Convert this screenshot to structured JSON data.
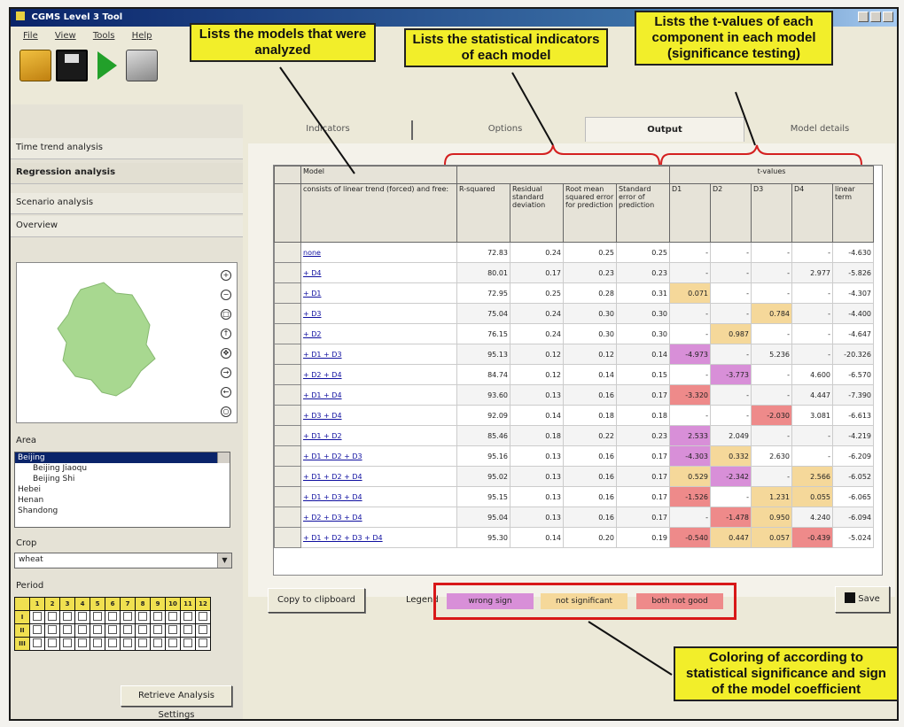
{
  "window": {
    "title": "CGMS Level 3 Tool"
  },
  "menu": [
    "File",
    "View",
    "Tools",
    "Help"
  ],
  "toolbar": [
    "open-icon",
    "save-icon",
    "run-icon",
    "print-icon"
  ],
  "sidebar": {
    "items": [
      "Time trend analysis",
      "Regression analysis",
      "Scenario analysis",
      "Overview"
    ],
    "area_label": "Area",
    "areas": [
      "Beijing",
      "Beijing Jiaoqu",
      "Beijing Shi",
      "Hebei",
      "Henan",
      "Shandong"
    ],
    "crop_label": "Crop",
    "crop_value": "wheat",
    "period_label": "Period",
    "period_header": [
      "1",
      "2",
      "3",
      "4",
      "5",
      "6",
      "7",
      "8",
      "9",
      "10",
      "11",
      "12"
    ],
    "period_rows": [
      "I",
      "II",
      "III"
    ],
    "retrieve_button": "Retrieve Analysis Settings"
  },
  "tabs": [
    "Indicators",
    "Options",
    "Output",
    "Model details"
  ],
  "active_tab": "Output",
  "grid": {
    "model_header": "Model",
    "model_subheader": "consists of linear trend (forced) and free:",
    "tvalue_header": "t-values",
    "columns": [
      "R-squared",
      "Residual standard deviation",
      "Root mean squared error for prediction",
      "Standard error of prediction",
      "D1",
      "D2",
      "D3",
      "D4",
      "linear term"
    ],
    "rows": [
      {
        "model": "none",
        "v": [
          "72.83",
          "0.24",
          "0.25",
          "0.25",
          "-",
          "-",
          "-",
          "-",
          "-4.630"
        ],
        "c": [
          "",
          "",
          "",
          "",
          "",
          "",
          "",
          "",
          ""
        ]
      },
      {
        "model": "+ D4",
        "v": [
          "80.01",
          "0.17",
          "0.23",
          "0.23",
          "-",
          "-",
          "-",
          "2.977",
          "-5.826"
        ],
        "c": [
          "",
          "",
          "",
          "",
          "",
          "",
          "",
          "",
          ""
        ]
      },
      {
        "model": "+ D1",
        "v": [
          "72.95",
          "0.25",
          "0.28",
          "0.31",
          "0.071",
          "-",
          "-",
          "-",
          "-4.307"
        ],
        "c": [
          "",
          "",
          "",
          "",
          "y",
          "",
          "",
          "",
          ""
        ]
      },
      {
        "model": "+ D3",
        "v": [
          "75.04",
          "0.24",
          "0.30",
          "0.30",
          "-",
          "-",
          "0.784",
          "-",
          "-4.400"
        ],
        "c": [
          "",
          "",
          "",
          "",
          "",
          "",
          "y",
          "",
          ""
        ]
      },
      {
        "model": "+ D2",
        "v": [
          "76.15",
          "0.24",
          "0.30",
          "0.30",
          "-",
          "0.987",
          "-",
          "-",
          "-4.647"
        ],
        "c": [
          "",
          "",
          "",
          "",
          "",
          "y",
          "",
          "",
          ""
        ]
      },
      {
        "model": "+ D1 + D3",
        "v": [
          "95.13",
          "0.12",
          "0.12",
          "0.14",
          "-4.973",
          "-",
          "5.236",
          "-",
          "-20.326"
        ],
        "c": [
          "",
          "",
          "",
          "",
          "m",
          "",
          "",
          "",
          ""
        ]
      },
      {
        "model": "+ D2 + D4",
        "v": [
          "84.74",
          "0.12",
          "0.14",
          "0.15",
          "-",
          "-3.773",
          "-",
          "4.600",
          "-6.570"
        ],
        "c": [
          "",
          "",
          "",
          "",
          "",
          "m",
          "",
          "",
          ""
        ]
      },
      {
        "model": "+ D1 + D4",
        "v": [
          "93.60",
          "0.13",
          "0.16",
          "0.17",
          "-3.320",
          "-",
          "-",
          "4.447",
          "-7.390"
        ],
        "c": [
          "",
          "",
          "",
          "",
          "r",
          "",
          "",
          "",
          ""
        ]
      },
      {
        "model": "+ D3 + D4",
        "v": [
          "92.09",
          "0.14",
          "0.18",
          "0.18",
          "-",
          "-",
          "-2.030",
          "3.081",
          "-6.613"
        ],
        "c": [
          "",
          "",
          "",
          "",
          "",
          "",
          "r",
          "",
          ""
        ]
      },
      {
        "model": "+ D1 + D2",
        "v": [
          "85.46",
          "0.18",
          "0.22",
          "0.23",
          "2.533",
          "2.049",
          "-",
          "-",
          "-4.219"
        ],
        "c": [
          "",
          "",
          "",
          "",
          "m",
          "",
          "",
          "",
          ""
        ]
      },
      {
        "model": "+ D1 + D2 + D3",
        "v": [
          "95.16",
          "0.13",
          "0.16",
          "0.17",
          "-4.303",
          "0.332",
          "2.630",
          "-",
          "-6.209"
        ],
        "c": [
          "",
          "",
          "",
          "",
          "m",
          "y",
          "",
          "",
          ""
        ]
      },
      {
        "model": "+ D1 + D2 + D4",
        "v": [
          "95.02",
          "0.13",
          "0.16",
          "0.17",
          "0.529",
          "-2.342",
          "-",
          "2.566",
          "-6.052"
        ],
        "c": [
          "",
          "",
          "",
          "",
          "y",
          "m",
          "",
          "y",
          ""
        ]
      },
      {
        "model": "+ D1 + D3 + D4",
        "v": [
          "95.15",
          "0.13",
          "0.16",
          "0.17",
          "-1.526",
          "-",
          "1.231",
          "0.055",
          "-6.065"
        ],
        "c": [
          "",
          "",
          "",
          "",
          "r",
          "",
          "y",
          "y",
          ""
        ]
      },
      {
        "model": "+ D2 + D3 + D4",
        "v": [
          "95.04",
          "0.13",
          "0.16",
          "0.17",
          "-",
          "-1.478",
          "0.950",
          "4.240",
          "-6.094"
        ],
        "c": [
          "",
          "",
          "",
          "",
          "",
          "r",
          "y",
          "",
          ""
        ]
      },
      {
        "model": "+ D1 + D2 + D3 + D4",
        "v": [
          "95.30",
          "0.14",
          "0.20",
          "0.19",
          "-0.540",
          "0.447",
          "0.057",
          "-0.439",
          "-5.024"
        ],
        "c": [
          "",
          "",
          "",
          "",
          "r",
          "y",
          "y",
          "r",
          ""
        ]
      }
    ]
  },
  "bottom": {
    "copy_button": "Copy to clipboard",
    "legend_label": "Legend",
    "legend": [
      {
        "label": "wrong sign",
        "color": "#d88fd8"
      },
      {
        "label": "not significant",
        "color": "#f5d89a"
      },
      {
        "label": "both not good",
        "color": "#ee8a8a"
      }
    ],
    "save_button": "Save"
  },
  "colors": {
    "m": "#d88fd8",
    "y": "#f5d89a",
    "r": "#ee8a8a"
  },
  "callouts": {
    "models": "Lists the models that were analyzed",
    "indicators": "Lists the statistical indicators of each model",
    "tvalues": "Lists the t-values of each component in each model (significance testing)",
    "coloring": "Coloring of according to statistical significance and sign of the model coefficient"
  }
}
